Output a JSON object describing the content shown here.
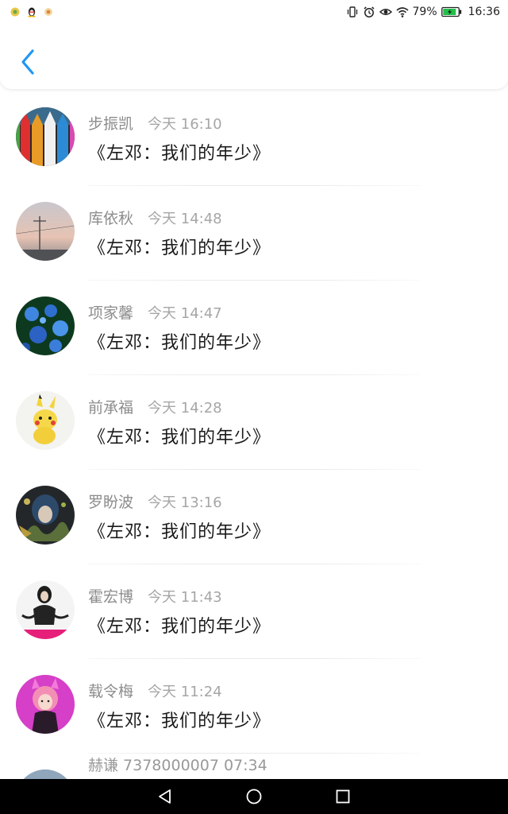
{
  "status_bar": {
    "battery_percent": "79%",
    "time": "16:36",
    "notification_icons": [
      "notification-app-icon",
      "qq-penguin-icon",
      "notification-app-icon"
    ],
    "system_icons": [
      "vibrate-icon",
      "alarm-icon",
      "eye-icon",
      "wifi-icon",
      "battery-charging-icon"
    ]
  },
  "header": {
    "back_icon": "chevron-left-icon",
    "accent": "#2196f3"
  },
  "comments": [
    {
      "name": "步振凯",
      "time": "今天 16:10",
      "text": "《左邓：我们的年少》"
    },
    {
      "name": "库依秋",
      "time": "今天 14:48",
      "text": "《左邓：我们的年少》"
    },
    {
      "name": "项家馨",
      "time": "今天 14:47",
      "text": "《左邓：我们的年少》"
    },
    {
      "name": "前承福",
      "time": "今天 14:28",
      "text": "《左邓：我们的年少》"
    },
    {
      "name": "罗盼波",
      "time": "今天 13:16",
      "text": "《左邓：我们的年少》"
    },
    {
      "name": "霍宏博",
      "time": "今天 11:43",
      "text": "《左邓：我们的年少》"
    },
    {
      "name": "载令梅",
      "time": "今天 11:24",
      "text": "《左邓：我们的年少》"
    }
  ],
  "partial_row": {
    "text": "赫谦 7378000007 07:34"
  },
  "nav_bar": {
    "back": "triangle-back-icon",
    "home": "circle-home-icon",
    "recents": "square-recents-icon"
  }
}
